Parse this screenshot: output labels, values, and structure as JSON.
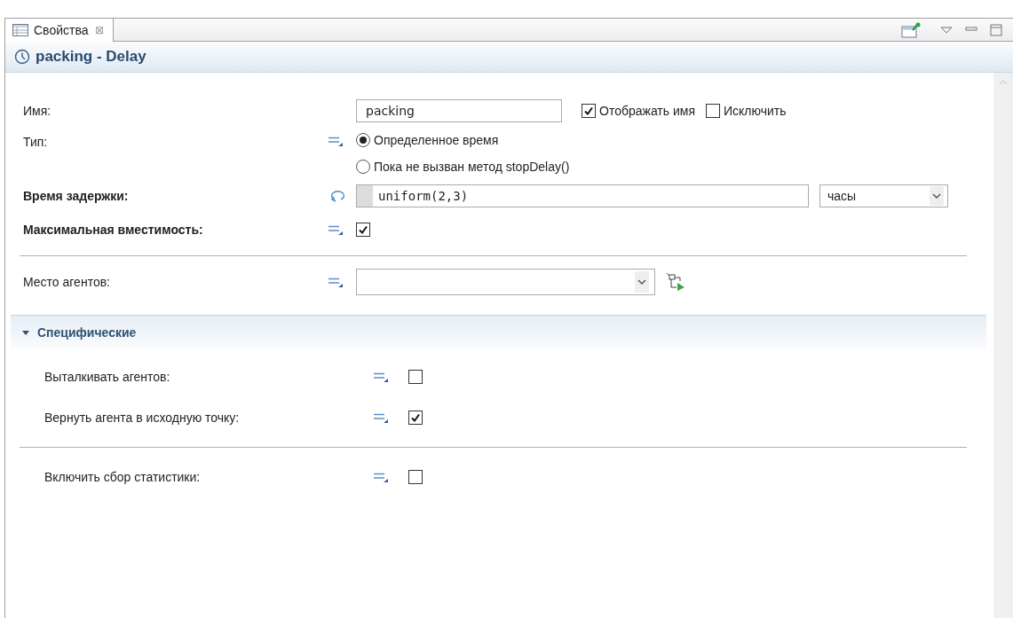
{
  "tab": {
    "label": "Свойства",
    "close": "⊠"
  },
  "title": "packing - Delay",
  "sections": [
    {
      "rows": [
        {
          "kind": "name",
          "label": "Имя:",
          "value": "packing",
          "checks": [
            {
              "label": "Отображать имя",
              "checked": true
            },
            {
              "label": "Исключить",
              "checked": false
            }
          ]
        },
        {
          "kind": "radio",
          "label": "Тип:",
          "options": [
            {
              "label": "Определенное время",
              "selected": true
            },
            {
              "label": "Пока не вызван метод stopDelay()",
              "selected": false
            }
          ]
        },
        {
          "kind": "expression",
          "label": "Время задержки:",
          "bold": true,
          "value": "uniform(2,3)",
          "unit": "часы"
        },
        {
          "kind": "checkbox",
          "label": "Максимальная вместимость:",
          "bold": true,
          "checked": true
        },
        {
          "kind": "divider"
        },
        {
          "kind": "dropdown",
          "label": "Место агентов:"
        }
      ]
    },
    {
      "header": {
        "title": "Специфические",
        "expanded": true
      },
      "rows": [
        {
          "kind": "checkbox",
          "label": "Выталкивать агентов:",
          "checked": false
        },
        {
          "kind": "checkbox",
          "label": "Вернуть агента в исходную точку:",
          "checked": true
        },
        {
          "kind": "divider"
        },
        {
          "kind": "checkbox",
          "label": "Включить сбор статистики:",
          "checked": false
        }
      ]
    }
  ]
}
